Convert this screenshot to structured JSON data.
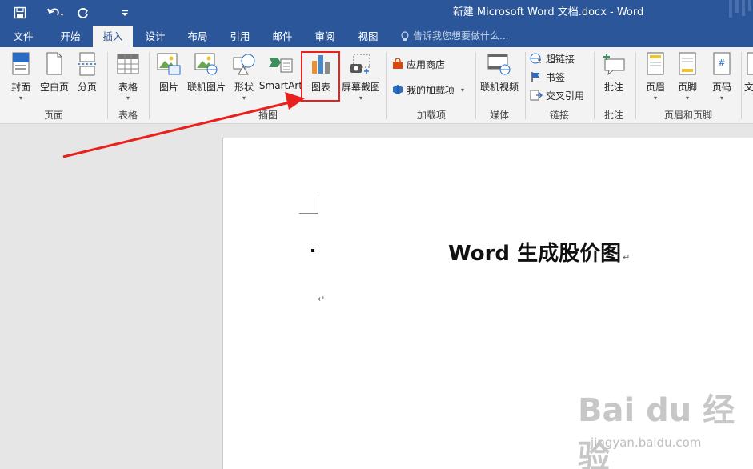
{
  "window": {
    "title": "新建 Microsoft Word 文档.docx - Word"
  },
  "qat": {
    "save_icon": "save-icon",
    "undo_icon": "undo-icon",
    "redo_icon": "redo-icon",
    "customize_icon": "customize-qat-icon"
  },
  "tabs": [
    {
      "label": "文件"
    },
    {
      "label": "开始"
    },
    {
      "label": "插入"
    },
    {
      "label": "设计"
    },
    {
      "label": "布局"
    },
    {
      "label": "引用"
    },
    {
      "label": "邮件"
    },
    {
      "label": "审阅"
    },
    {
      "label": "视图"
    }
  ],
  "active_tab": "插入",
  "tellme": {
    "placeholder": "告诉我您想要做什么..."
  },
  "ribbon": {
    "pages_group": {
      "label": "页面",
      "cover": "封面",
      "blank": "空白页",
      "break": "分页"
    },
    "table_group": {
      "label": "表格",
      "table": "表格"
    },
    "illustrations_group": {
      "label": "插图",
      "picture": "图片",
      "online_picture": "联机图片",
      "shapes": "形状",
      "smartart": "SmartArt",
      "chart": "图表",
      "screenshot": "屏幕截图"
    },
    "addins_group": {
      "label": "加载项",
      "store": "应用商店",
      "my_addins": "我的加载项"
    },
    "media_group": {
      "label": "媒体",
      "online_video": "联机视频"
    },
    "links_group": {
      "label": "链接",
      "hyperlink": "超链接",
      "bookmark": "书签",
      "cross_ref": "交叉引用"
    },
    "comments_group": {
      "label": "批注",
      "comment": "批注"
    },
    "header_footer_group": {
      "label": "页眉和页脚",
      "header": "页眉",
      "footer": "页脚",
      "page_number": "页码"
    },
    "text_group": {
      "partial": "文"
    }
  },
  "document": {
    "title": "Word 生成股价图",
    "para_mark": "↵"
  },
  "watermark": {
    "brand": "Bai du 经验",
    "url": "jingyan.baidu.com"
  },
  "colors": {
    "brand_blue": "#2b579a",
    "highlight_red": "#e8211c"
  }
}
